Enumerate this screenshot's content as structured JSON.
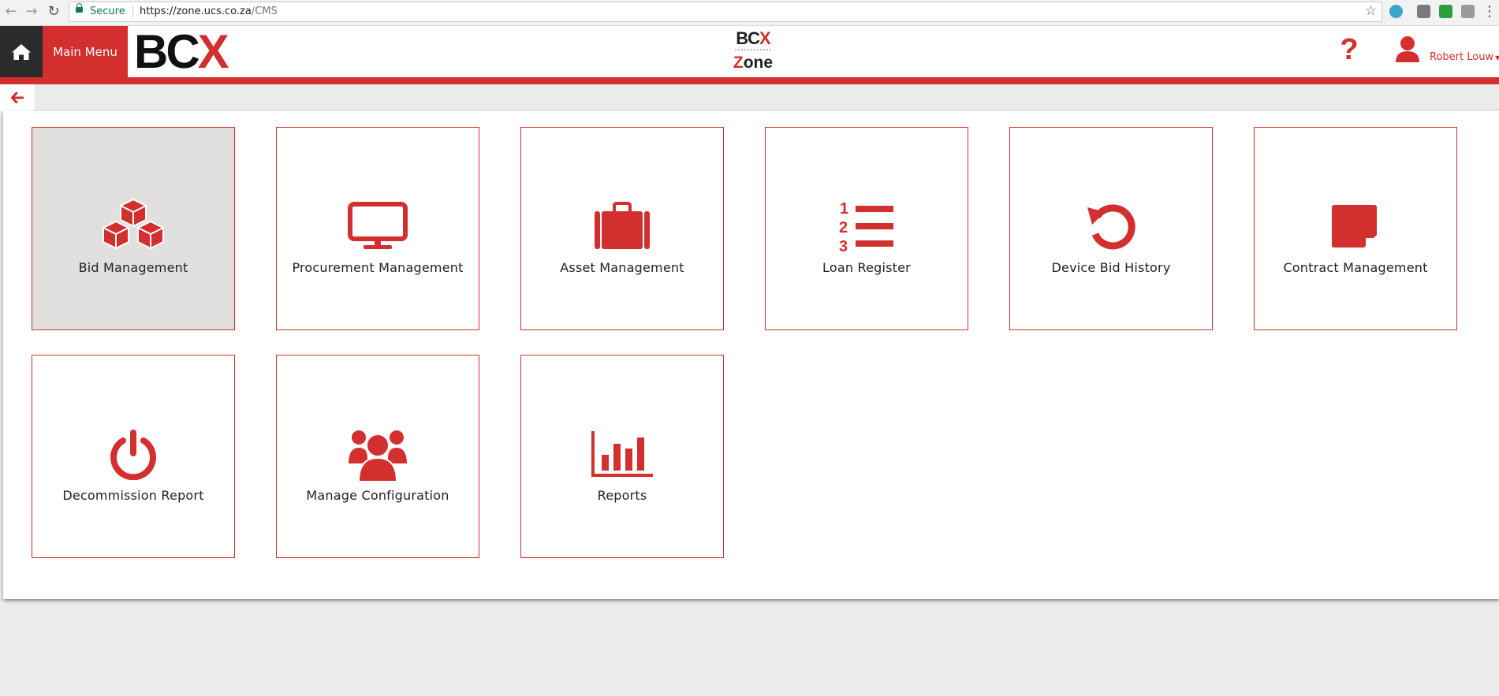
{
  "browser": {
    "secure_label": "Secure",
    "url_host": "https://zone.ucs.co.za",
    "url_path": "/CMS"
  },
  "header": {
    "main_menu_label": "Main Menu",
    "brand_left": "BC",
    "brand_right": "X",
    "center_logo_top_left": "BC",
    "center_logo_top_right": "X",
    "center_logo_bottom_first": "Z",
    "center_logo_bottom_rest": "one",
    "help_label": "?",
    "user_name": "Robert Louw"
  },
  "tiles": [
    {
      "label": "Bid Management",
      "icon": "cubes-icon",
      "active": true
    },
    {
      "label": "Procurement Management",
      "icon": "monitor-icon"
    },
    {
      "label": "Asset Management",
      "icon": "briefcase-icon"
    },
    {
      "label": "Loan Register",
      "icon": "numbered-list-icon"
    },
    {
      "label": "Device Bid History",
      "icon": "history-icon"
    },
    {
      "label": "Contract Management",
      "icon": "sticky-note-icon"
    },
    {
      "label": "Decommission Report",
      "icon": "power-icon"
    },
    {
      "label": "Manage Configuration",
      "icon": "users-icon"
    },
    {
      "label": "Reports",
      "icon": "bar-chart-icon"
    }
  ],
  "colors": {
    "accent": "#d32f2f",
    "dark": "#2b2b2b",
    "active_tile": "#e2dfdf",
    "secure_green": "#0b8043"
  }
}
